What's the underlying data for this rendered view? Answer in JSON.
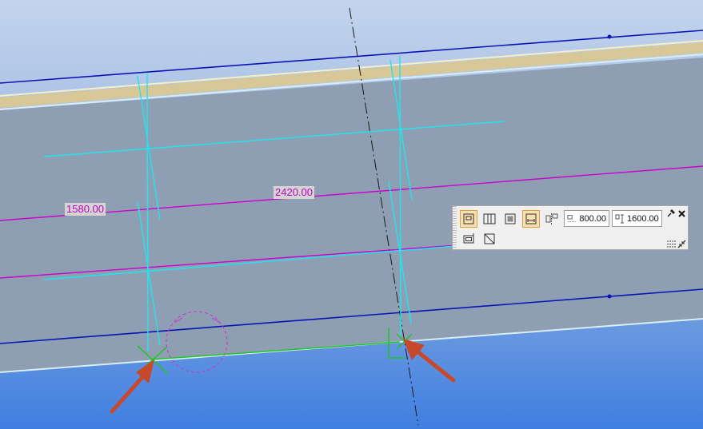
{
  "dimensions": {
    "left_value": "1580.00",
    "right_value": "2420.00"
  },
  "toolbar": {
    "buttons": [
      {
        "name": "rect-frame-mode-button",
        "icon": "rect-frame-icon",
        "active": true
      },
      {
        "name": "columns-mode-button",
        "icon": "columns-icon",
        "active": false
      },
      {
        "name": "filled-rect-mode-button",
        "icon": "filled-rect-icon",
        "active": false
      },
      {
        "name": "rect-dimension-mode-button",
        "icon": "rect-dimension-icon",
        "active": true
      },
      {
        "name": "distribute-mode-button",
        "icon": "distribute-icon",
        "active": false
      },
      {
        "name": "outline-rect-button",
        "icon": "outline-rect-icon",
        "active": false
      },
      {
        "name": "diagonal-rect-button",
        "icon": "diagonal-rect-icon",
        "active": false
      }
    ],
    "field_width": "800.00",
    "field_height": "1600.00",
    "pin_icon": "pin-icon",
    "close_icon": "close-icon",
    "list_icon": "list-icon",
    "collapse_icon": "collapse-icon"
  },
  "colors": {
    "background_top": "#b9cdea",
    "background_bottom": "#4a82e3",
    "wall_fill": "#8e9fb3",
    "beam_fill": "#d8c999",
    "axis_blue": "#0a14b4",
    "dimension_magenta": "#cc00cc",
    "construction_cyan": "#1fe6ee",
    "snap_green": "#22c422",
    "arrow_red": "#c8482c"
  }
}
